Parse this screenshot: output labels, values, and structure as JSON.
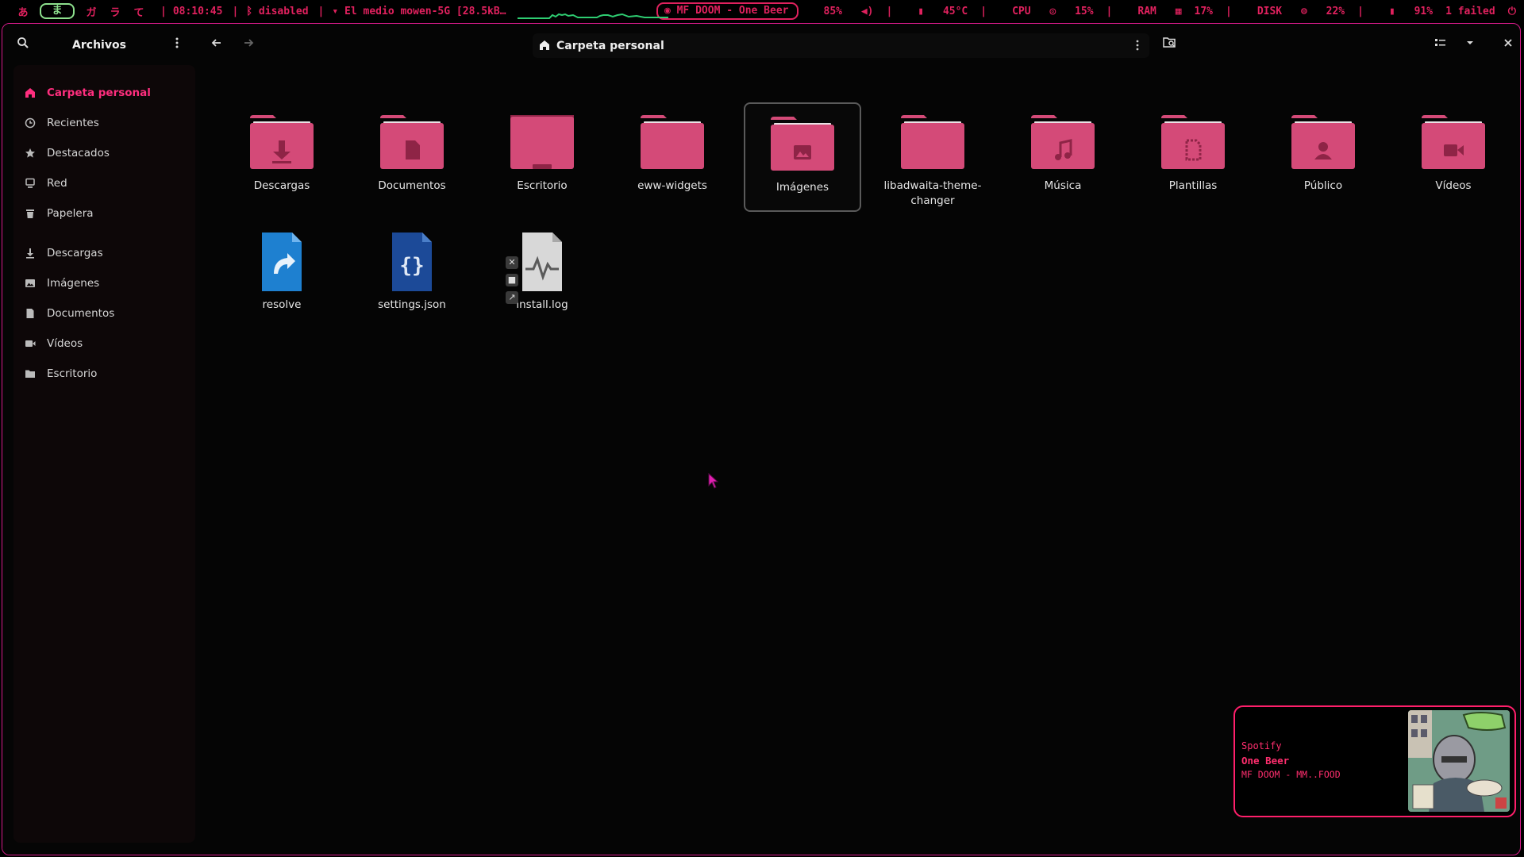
{
  "topbar": {
    "workspaces": [
      "あ",
      "ま",
      "ガ",
      "ラ",
      "て"
    ],
    "active_workspace": 1,
    "time": "08:10:45",
    "bluetooth": "disabled",
    "wifi": "El medio mowen-5G [",
    "net_speed": "28.5kB…",
    "now_playing": "MF DOOM - One Beer",
    "volume": "85%",
    "temperature": "45°C",
    "cpu_label": "CPU",
    "cpu": "15%",
    "ram_label": "RAM",
    "ram": "17%",
    "disk_label": "DISK",
    "disk": "22%",
    "battery": "91%",
    "failed": "1 failed"
  },
  "sidebar": {
    "title": "Archivos",
    "places": [
      {
        "label": "Carpeta personal",
        "icon": "home-icon",
        "active": true
      },
      {
        "label": "Recientes",
        "icon": "clock-icon"
      },
      {
        "label": "Destacados",
        "icon": "star-icon"
      },
      {
        "label": "Red",
        "icon": "network-icon"
      },
      {
        "label": "Papelera",
        "icon": "trash-icon"
      }
    ],
    "bookmarks": [
      {
        "label": "Descargas",
        "icon": "download-icon"
      },
      {
        "label": "Imágenes",
        "icon": "image-icon"
      },
      {
        "label": "Documentos",
        "icon": "document-icon"
      },
      {
        "label": "Vídeos",
        "icon": "video-icon"
      },
      {
        "label": "Escritorio",
        "icon": "folder-icon"
      }
    ]
  },
  "header": {
    "location": "Carpeta personal"
  },
  "files": [
    {
      "name": "Descargas",
      "kind": "folder",
      "emblem": "download"
    },
    {
      "name": "Documentos",
      "kind": "folder",
      "emblem": "document"
    },
    {
      "name": "Escritorio",
      "kind": "folder",
      "emblem": "desktop"
    },
    {
      "name": "eww-widgets",
      "kind": "folder",
      "emblem": ""
    },
    {
      "name": "Imágenes",
      "kind": "folder",
      "emblem": "image",
      "selected": true
    },
    {
      "name": "libadwaita-theme-changer",
      "kind": "folder",
      "emblem": ""
    },
    {
      "name": "Música",
      "kind": "folder",
      "emblem": "music"
    },
    {
      "name": "Plantillas",
      "kind": "folder",
      "emblem": "template"
    },
    {
      "name": "Público",
      "kind": "folder",
      "emblem": "user"
    },
    {
      "name": "Vídeos",
      "kind": "folder",
      "emblem": "video"
    },
    {
      "name": "resolve",
      "kind": "link"
    },
    {
      "name": "settings.json",
      "kind": "json"
    },
    {
      "name": "install.log",
      "kind": "log"
    }
  ],
  "spotify": {
    "source": "Spotify",
    "title": "One Beer",
    "artist_album": "MF DOOM - MM..FOOD"
  },
  "colors": {
    "accent": "#ff2e7e",
    "folder": "#d44a78",
    "folder_dark": "#8e2446",
    "bar_text": "#e0215e",
    "window_border": "#d81b8c"
  }
}
